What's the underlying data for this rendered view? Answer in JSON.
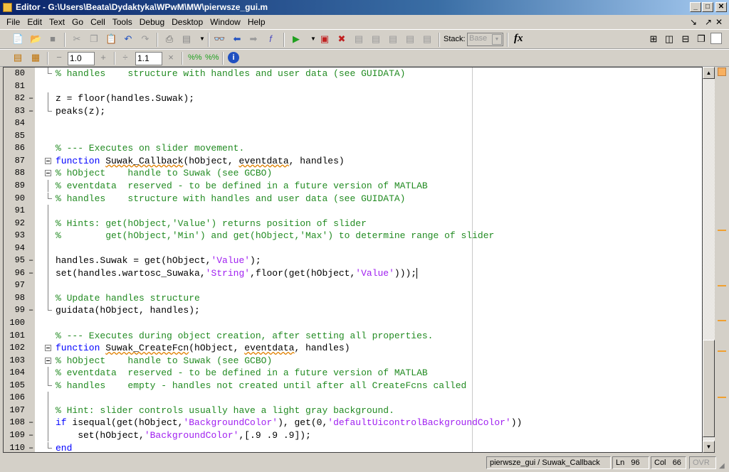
{
  "window": {
    "title": "Editor - G:\\Users\\Beata\\Dydaktyka\\WPwM\\MW\\pierwsze_gui.m",
    "minimize": "_",
    "maximize": "□",
    "close": "✕"
  },
  "menu": [
    "File",
    "Edit",
    "Text",
    "Go",
    "Cell",
    "Tools",
    "Debug",
    "Desktop",
    "Window",
    "Help"
  ],
  "dock": {
    "undock": "↘",
    "dock": "↗",
    "close": "✕"
  },
  "toolbar": {
    "stack_label": "Stack:",
    "stack_value": "Base",
    "fx": "fx"
  },
  "cell_toolbar": {
    "minus": "−",
    "decrement_value": "1.0",
    "plus": "+",
    "divide": "÷",
    "factor_value": "1.1",
    "times": "×"
  },
  "colors": {
    "comment": "#228B22",
    "keyword": "#0000FF",
    "string": "#A020F0",
    "marker": "#F0A030"
  },
  "lines": [
    {
      "n": "80",
      "dash": false,
      "fold": "end",
      "seg": [
        [
          "c",
          "% handles    structure with handles and user data (see GUIDATA)"
        ]
      ]
    },
    {
      "n": "81",
      "dash": false,
      "fold": "",
      "seg": []
    },
    {
      "n": "82",
      "dash": true,
      "fold": "bar",
      "seg": [
        [
          "n",
          "z = floor(handles.Suwak);"
        ]
      ]
    },
    {
      "n": "83",
      "dash": true,
      "fold": "end",
      "seg": [
        [
          "n",
          "peaks(z);"
        ]
      ]
    },
    {
      "n": "84",
      "dash": false,
      "fold": "",
      "seg": []
    },
    {
      "n": "85",
      "dash": false,
      "fold": "",
      "seg": []
    },
    {
      "n": "86",
      "dash": false,
      "fold": "",
      "seg": [
        [
          "c",
          "% --- Executes on slider movement."
        ]
      ]
    },
    {
      "n": "87",
      "dash": false,
      "fold": "box",
      "seg": [
        [
          "k",
          "function "
        ],
        [
          "sq",
          "Suwak_Callback"
        ],
        [
          "n",
          "(hObject, "
        ],
        [
          "sq",
          "eventdata"
        ],
        [
          "n",
          ", handles)"
        ]
      ]
    },
    {
      "n": "88",
      "dash": false,
      "fold": "box",
      "seg": [
        [
          "c",
          "% hObject    handle to Suwak (see GCBO)"
        ]
      ]
    },
    {
      "n": "89",
      "dash": false,
      "fold": "bar",
      "seg": [
        [
          "c",
          "% eventdata  reserved - to be defined in a future version of MATLAB"
        ]
      ]
    },
    {
      "n": "90",
      "dash": false,
      "fold": "end",
      "seg": [
        [
          "c",
          "% handles    structure with handles and user data (see GUIDATA)"
        ]
      ]
    },
    {
      "n": "91",
      "dash": false,
      "fold": "bar",
      "seg": []
    },
    {
      "n": "92",
      "dash": false,
      "fold": "bar",
      "seg": [
        [
          "c",
          "% Hints: get(hObject,'Value') returns position of slider"
        ]
      ]
    },
    {
      "n": "93",
      "dash": false,
      "fold": "bar",
      "seg": [
        [
          "c",
          "%        get(hObject,'Min') and get(hObject,'Max') to determine range of slider"
        ]
      ]
    },
    {
      "n": "94",
      "dash": false,
      "fold": "bar",
      "seg": []
    },
    {
      "n": "95",
      "dash": true,
      "fold": "bar",
      "seg": [
        [
          "n",
          "handles.Suwak = get(hObject,"
        ],
        [
          "s",
          "'Value'"
        ],
        [
          "n",
          ");"
        ]
      ]
    },
    {
      "n": "96",
      "dash": true,
      "fold": "bar",
      "cursor": true,
      "seg": [
        [
          "n",
          "set(handles.wartosc_Suwaka,"
        ],
        [
          "s",
          "'String'"
        ],
        [
          "n",
          ",floor(get(hObject,"
        ],
        [
          "s",
          "'Value'"
        ],
        [
          "n",
          ")));"
        ]
      ]
    },
    {
      "n": "97",
      "dash": false,
      "fold": "bar",
      "seg": []
    },
    {
      "n": "98",
      "dash": false,
      "fold": "bar",
      "seg": [
        [
          "c",
          "% Update handles structure"
        ]
      ]
    },
    {
      "n": "99",
      "dash": true,
      "fold": "end",
      "seg": [
        [
          "n",
          "guidata(hObject, handles);"
        ]
      ]
    },
    {
      "n": "100",
      "dash": false,
      "fold": "",
      "seg": []
    },
    {
      "n": "101",
      "dash": false,
      "fold": "",
      "seg": [
        [
          "c",
          "% --- Executes during object creation, after setting all properties."
        ]
      ]
    },
    {
      "n": "102",
      "dash": false,
      "fold": "box",
      "seg": [
        [
          "k",
          "function "
        ],
        [
          "sq",
          "Suwak_CreateFcn"
        ],
        [
          "n",
          "(hObject, "
        ],
        [
          "sq",
          "eventdata"
        ],
        [
          "n",
          ", handles)"
        ]
      ]
    },
    {
      "n": "103",
      "dash": false,
      "fold": "box",
      "seg": [
        [
          "c",
          "% hObject    handle to Suwak (see GCBO)"
        ]
      ]
    },
    {
      "n": "104",
      "dash": false,
      "fold": "bar",
      "seg": [
        [
          "c",
          "% eventdata  reserved - to be defined in a future version of MATLAB"
        ]
      ]
    },
    {
      "n": "105",
      "dash": false,
      "fold": "end",
      "seg": [
        [
          "c",
          "% handles    empty - handles not created until after all CreateFcns called"
        ]
      ]
    },
    {
      "n": "106",
      "dash": false,
      "fold": "bar",
      "seg": []
    },
    {
      "n": "107",
      "dash": false,
      "fold": "bar",
      "seg": [
        [
          "c",
          "% Hint: slider controls usually have a light gray background."
        ]
      ]
    },
    {
      "n": "108",
      "dash": true,
      "fold": "bar",
      "seg": [
        [
          "k",
          "if "
        ],
        [
          "n",
          "isequal(get(hObject,"
        ],
        [
          "s",
          "'BackgroundColor'"
        ],
        [
          "n",
          "), get(0,"
        ],
        [
          "s",
          "'defaultUicontrolBackgroundColor'"
        ],
        [
          "n",
          "))"
        ]
      ]
    },
    {
      "n": "109",
      "dash": true,
      "fold": "bar",
      "seg": [
        [
          "n",
          "    set(hObject,"
        ],
        [
          "s",
          "'BackgroundColor'"
        ],
        [
          "n",
          ",[.9 .9 .9]);"
        ]
      ]
    },
    {
      "n": "110",
      "dash": true,
      "fold": "end",
      "seg": [
        [
          "k",
          "end"
        ]
      ]
    }
  ],
  "status": {
    "context": "pierwsze_gui / Suwak_Callback",
    "ln_label": "Ln",
    "ln": "96",
    "col_label": "Col",
    "col": "66",
    "ovr": "OVR"
  }
}
